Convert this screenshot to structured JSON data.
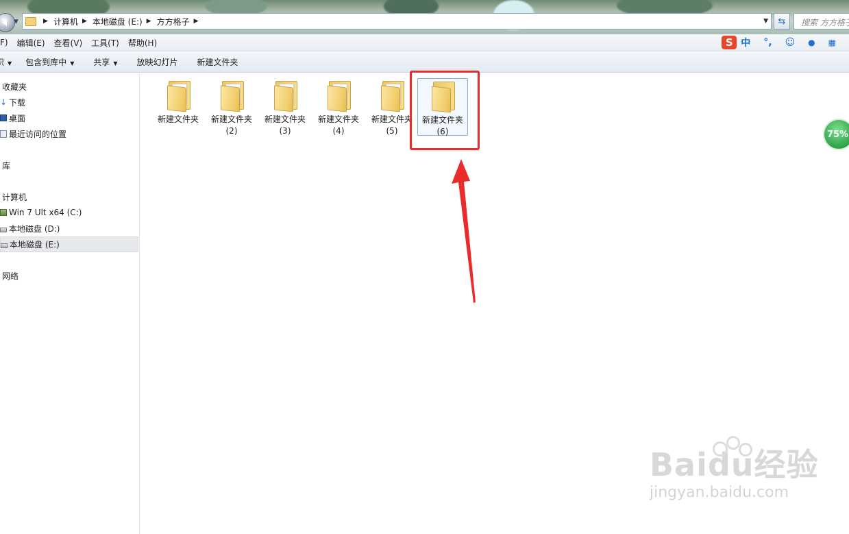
{
  "breadcrumb": {
    "items": [
      "计算机",
      "本地磁盘 (E:)",
      "方方格子"
    ]
  },
  "search": {
    "placeholder": "搜索 方方格子"
  },
  "menu": {
    "items": [
      "F)",
      "编辑(E)",
      "查看(V)",
      "工具(T)",
      "帮助(H)"
    ]
  },
  "ime": {
    "logo": "S",
    "items": [
      "中",
      "°,",
      "☺",
      "🎤",
      "▦"
    ]
  },
  "toolbar": {
    "organize": "织",
    "include_in_library": "包含到库中",
    "share": "共享",
    "slideshow": "放映幻灯片",
    "new_folder": "新建文件夹"
  },
  "sidebar": {
    "favorites_header": "收藏夹",
    "favorites": [
      "下载",
      "桌面",
      "最近访问的位置"
    ],
    "libraries_header": "库",
    "computer_header": "计算机",
    "drives": [
      "Win 7 Ult x64 (C:)",
      "本地磁盘 (D:)",
      "本地磁盘 (E:)"
    ],
    "network_header": "网络"
  },
  "folders": [
    {
      "name": "新建文件夹",
      "index": ""
    },
    {
      "name": "新建文件夹",
      "index": "(2)"
    },
    {
      "name": "新建文件夹",
      "index": "(3)"
    },
    {
      "name": "新建文件夹",
      "index": "(4)"
    },
    {
      "name": "新建文件夹",
      "index": "(5)"
    },
    {
      "name": "新建文件夹",
      "index": "(6)"
    }
  ],
  "selected_folder_index": 5,
  "progress_badge": {
    "text": "75%",
    "value": 0.75
  },
  "watermark": {
    "main": "Baidu经验",
    "sub": "jingyan.baidu.com"
  },
  "colors": {
    "annotation_red": "#ea2b2b",
    "selection_border": "#84acdd",
    "badge_green": "#2fa44a",
    "ime_red": "#e8462a"
  }
}
